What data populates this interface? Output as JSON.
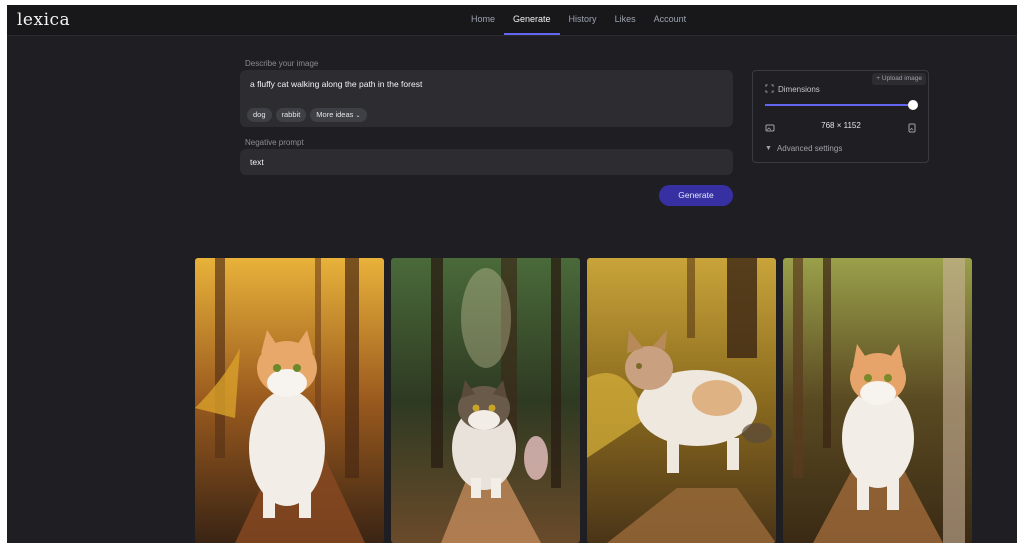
{
  "app": {
    "logo": "lexica"
  },
  "nav": {
    "items": [
      {
        "label": "Home"
      },
      {
        "label": "Generate"
      },
      {
        "label": "History"
      },
      {
        "label": "Likes"
      },
      {
        "label": "Account"
      }
    ],
    "active": "Generate"
  },
  "prompt": {
    "label": "Describe your image",
    "value": "a fluffy cat walking along the path in the forest",
    "suggestions": [
      "dog",
      "rabbit",
      "More ideas"
    ]
  },
  "negative_prompt": {
    "label": "Negative prompt",
    "value": "text"
  },
  "generate_button": {
    "label": "Generate"
  },
  "dimensions": {
    "title": "Dimensions",
    "upload_label": "+ Upload image",
    "value": "768 × 1152",
    "slider_fraction": 1.0,
    "advanced_label": "Advanced settings"
  },
  "colors": {
    "accent": "#6366f1",
    "button": "#3730a3",
    "background": "#1f1f23"
  },
  "gallery": {
    "images": [
      {
        "name": "generated-image-1"
      },
      {
        "name": "generated-image-2"
      },
      {
        "name": "generated-image-3"
      },
      {
        "name": "generated-image-4"
      }
    ]
  }
}
